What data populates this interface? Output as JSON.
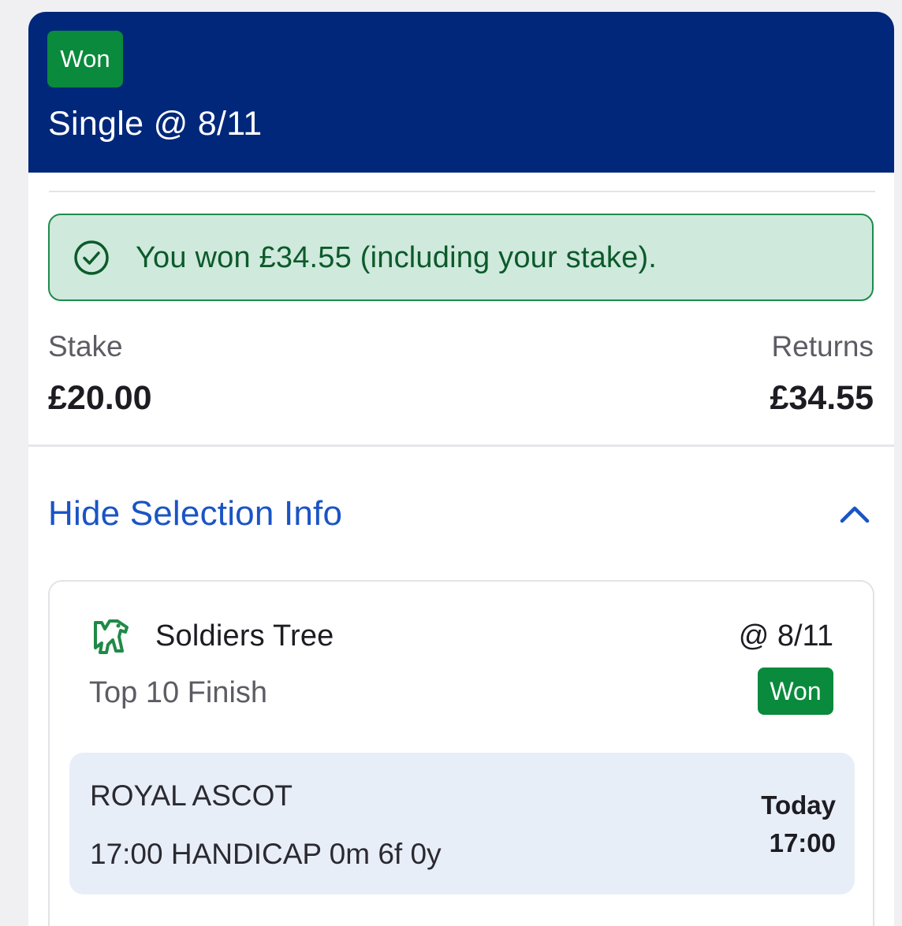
{
  "bet": {
    "status": "Won",
    "title": "Single @ 8/11"
  },
  "result": {
    "message": "You won £34.55 (including your stake)."
  },
  "summary": {
    "stake_label": "Stake",
    "stake_value": "£20.00",
    "returns_label": "Returns",
    "returns_value": "£34.55"
  },
  "selection_toggle": {
    "label": "Hide Selection Info",
    "icon": "chevron-up-icon"
  },
  "selection": {
    "icon": "horse-racing-icon",
    "name": "Soldiers Tree",
    "odds": "@ 8/11",
    "market": "Top 10 Finish",
    "status": "Won",
    "event": {
      "venue": "ROYAL ASCOT",
      "race": "17:00 HANDICAP 0m 6f 0y",
      "day": "Today",
      "time": "17:00"
    }
  },
  "colors": {
    "header_bg": "#01277a",
    "won_badge": "#0a8a3c",
    "win_banner_bg": "#cfe9dc",
    "win_banner_text": "#0c5a2b",
    "link": "#1a54c6",
    "event_box_bg": "#e8eef8"
  }
}
